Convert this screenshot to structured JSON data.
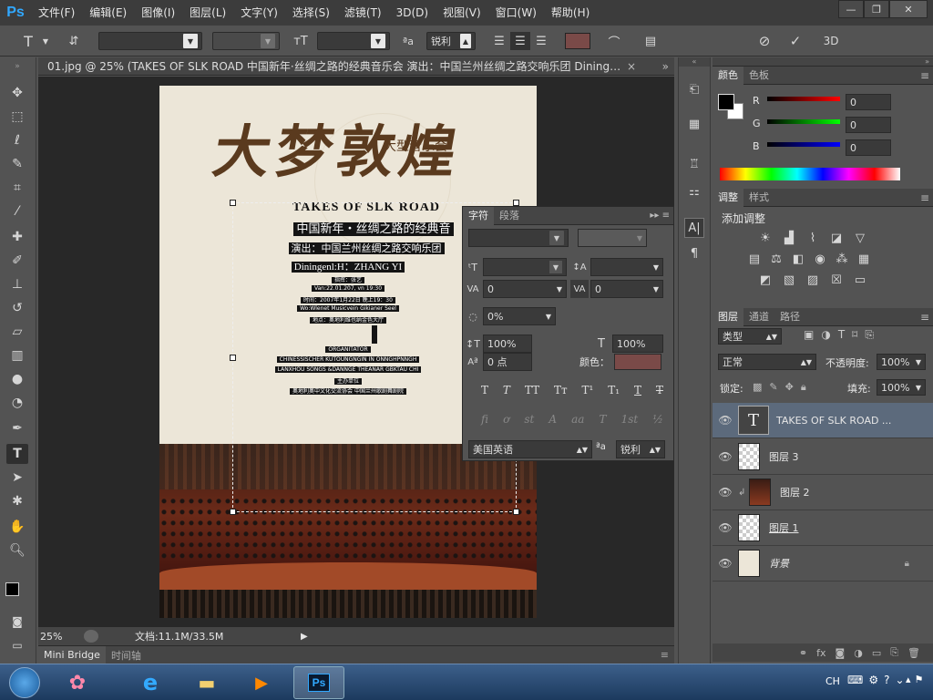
{
  "app": {
    "logo": "Ps"
  },
  "menu": [
    "文件(F)",
    "编辑(E)",
    "图像(I)",
    "图层(L)",
    "文字(Y)",
    "选择(S)",
    "滤镜(T)",
    "3D(D)",
    "视图(V)",
    "窗口(W)",
    "帮助(H)"
  ],
  "window_controls": {
    "minimize": "—",
    "restore": "❐",
    "close": "✕"
  },
  "options": {
    "tool_glyph": "T",
    "antialias": "锐利",
    "threed": "3D"
  },
  "document": {
    "tab_title": "01.jpg @ 25% (TAKES  OF  SLK  ROAD 中国新年·丝绸之路的经典音乐会 演出：中国兰州丝绸之路交响乐团 Dininge...",
    "zoom": "25%",
    "doc_size": "文档:11.1M/33.5M"
  },
  "poster": {
    "calligraphy": "大梦敦煌",
    "subtitle": "大型音乐会",
    "title_en": "TAKES  OF  SLK  ROAD",
    "title_cn": "中国新年・丝绸之路的经典音",
    "perform": "演出：中国兰州丝绸之路交响乐团",
    "conductor": "Diningenl:H：ZHANG YI",
    "small_lines": [
      "指挥：张艺",
      "Van:22.01.207, vn 19:30",
      "时间：2007年1月22日 晚上19：30",
      "Wo:Wlenet Musicvein Gikianer Seel",
      "地点：奥地利维也纳金色大厅"
    ],
    "org_lines": [
      "ORGANITATOR",
      "CHINESSISCHER KUTOUNGNGIN IN ONNGHPNNGH",
      "LANXHOU SONGS &DANNGE THEANAR GBKTAU CHI",
      "主办单位",
      "奥地利奥中文化交流协会  中国兰州歌剧舞剧院"
    ]
  },
  "bottom_tabs": {
    "bridge": "Mini Bridge",
    "timeline": "时间轴"
  },
  "char_panel": {
    "tabs": [
      "字符",
      "段落"
    ],
    "kerning": "0",
    "tracking": "0",
    "scale_pct": "0%",
    "vscale": "100%",
    "hscale": "100%",
    "baseline": "0 点",
    "color_label": "颜色：",
    "styles": [
      "T",
      "T",
      "TT",
      "Tт",
      "T¹",
      "T₁",
      "T",
      "T"
    ],
    "ot": [
      "fi",
      "ơ",
      "st",
      "A",
      "aa",
      "T",
      "1st",
      "½"
    ],
    "language": "美国英语",
    "aa_label": "ªa",
    "aa_value": "锐利"
  },
  "color_panel": {
    "tabs": [
      "颜色",
      "色板"
    ],
    "r_label": "R",
    "g_label": "G",
    "b_label": "B",
    "r": "0",
    "g": "0",
    "b": "0"
  },
  "adjust_panel": {
    "tabs": [
      "调整",
      "样式"
    ],
    "title": "添加调整"
  },
  "layers_panel": {
    "tabs": [
      "图层",
      "通道",
      "路径"
    ],
    "filter": "类型",
    "blend_mode": "正常",
    "opacity_label": "不透明度:",
    "opacity": "100%",
    "lock_label": "锁定:",
    "fill_label": "填充:",
    "fill": "100%",
    "layers": [
      {
        "name": "TAKES  OF  SLK  ROAD ..."
      },
      {
        "name": "图层 3"
      },
      {
        "name": "图层 2"
      },
      {
        "name": "图层 1"
      },
      {
        "name": "背景"
      }
    ]
  },
  "taskbar": {
    "lang": "CH"
  },
  "colors": {
    "accent": "#31a8ff",
    "fg_swatch": "#000000",
    "bg_swatch": "#ffffff",
    "text_color": "#7a4a48"
  }
}
